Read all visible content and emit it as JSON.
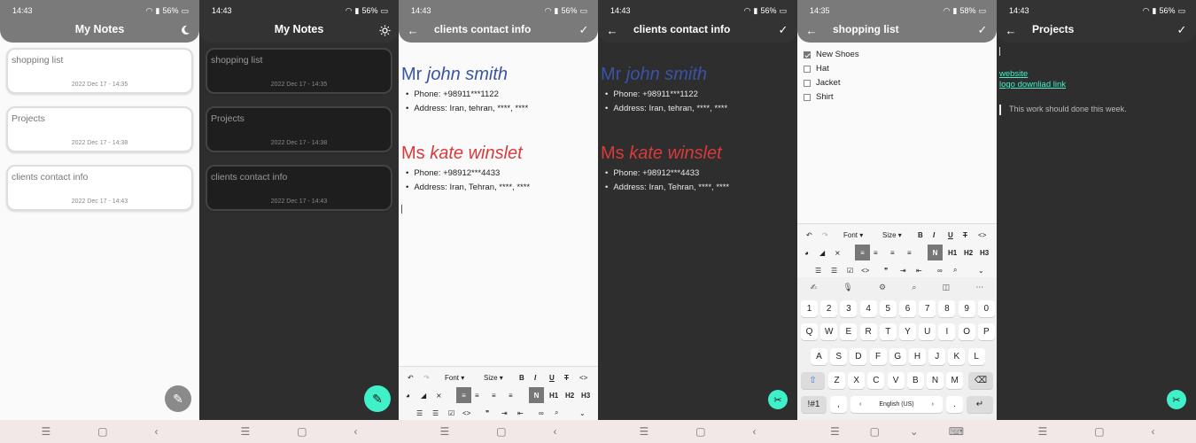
{
  "screens": [
    {
      "status_time": "14:43",
      "status_battery": "56%",
      "title": "My Notes",
      "theme_icon": "moon-icon",
      "notes": [
        {
          "title": "shopping list",
          "date": "2022 Dec 17 - 14:35"
        },
        {
          "title": "Projects",
          "date": "2022 Dec 17 - 14:38"
        },
        {
          "title": "clients contact info",
          "date": "2022 Dec 17 - 14:43"
        }
      ]
    },
    {
      "status_time": "14:43",
      "status_battery": "56%",
      "title": "My Notes",
      "theme_icon": "sun-icon",
      "notes": [
        {
          "title": "shopping list",
          "date": "2022 Dec 17 - 14:35"
        },
        {
          "title": "Projects",
          "date": "2022 Dec 17 - 14:38"
        },
        {
          "title": "clients contact info",
          "date": "2022 Dec 17 - 14:43"
        }
      ]
    },
    {
      "status_time": "14:43",
      "status_battery": "56%",
      "title": "clients contact info"
    },
    {
      "status_time": "14:43",
      "status_battery": "56%",
      "title": "clients contact info"
    },
    {
      "status_time": "14:35",
      "status_battery": "58%",
      "title": "shopping list",
      "items": [
        {
          "label": "New Shoes",
          "checked": true
        },
        {
          "label": "Hat",
          "checked": false
        },
        {
          "label": "Jacket",
          "checked": false
        },
        {
          "label": "Shirt",
          "checked": false
        }
      ]
    },
    {
      "status_time": "14:43",
      "status_battery": "56%",
      "title": "Projects",
      "links": [
        "website",
        "logo downliad link"
      ],
      "quote": "This work should done this week."
    }
  ],
  "contacts": [
    {
      "prefix": "Mr",
      "name": "john smith",
      "phone": "Phone: +98911***1122",
      "address": "Address: Iran, tehran, ****, ****",
      "color": "#3b53a4"
    },
    {
      "prefix": "Ms",
      "name": "kate winslet",
      "phone": "Phone: +98912***4433",
      "address": "Address: Iran, Tehran, ****, ****",
      "color": "#d93a3a"
    }
  ],
  "toolbar": {
    "font": "Font",
    "size": "Size",
    "bold": "B",
    "italic": "I",
    "underline": "U",
    "strike": "T",
    "code": "<>",
    "normal": "N",
    "h1": "H1",
    "h2": "H2",
    "h3": "H3",
    "quote": "❞"
  },
  "keyboard": {
    "row1": [
      "1",
      "2",
      "3",
      "4",
      "5",
      "6",
      "7",
      "8",
      "9",
      "0"
    ],
    "row2": [
      "Q",
      "W",
      "E",
      "R",
      "T",
      "Y",
      "U",
      "I",
      "O",
      "P"
    ],
    "row3": [
      "A",
      "S",
      "D",
      "F",
      "G",
      "H",
      "J",
      "K",
      "L"
    ],
    "row4": [
      "Z",
      "X",
      "C",
      "V",
      "B",
      "N",
      "M"
    ],
    "symbols": "!#1",
    "comma": ",",
    "space": "English (US)",
    "period": "."
  },
  "colors": {
    "accent": "#3ff0c8",
    "appbar_light": "#7a7a7a",
    "appbar_dark": "#333333",
    "fab_gray": "#8a8a8a"
  }
}
